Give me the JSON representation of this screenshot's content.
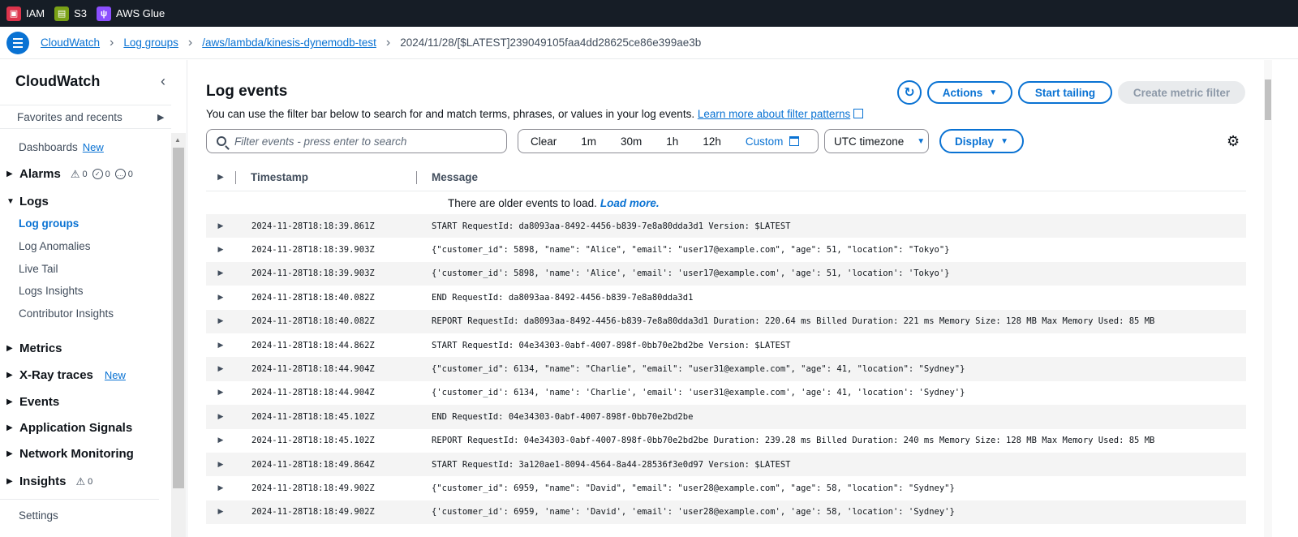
{
  "topbar": {
    "services": [
      {
        "label": "IAM",
        "icon": "iam-icon",
        "color": "#dd344c"
      },
      {
        "label": "S3",
        "icon": "s3-icon",
        "color": "#7aa116"
      },
      {
        "label": "AWS Glue",
        "icon": "glue-icon",
        "color": "#8c4fff"
      }
    ]
  },
  "breadcrumb": {
    "items": [
      "CloudWatch",
      "Log groups",
      "/aws/lambda/kinesis-dynemodb-test"
    ],
    "current": "2024/11/28/[$LATEST]239049105faa4dd28625ce86e399ae3b"
  },
  "sidebar": {
    "title": "CloudWatch",
    "favorites": "Favorites and recents",
    "dashboards": "Dashboards",
    "new_badge": "New",
    "alarms": {
      "label": "Alarms",
      "warn": "0",
      "ok": "0",
      "insufficient": "0"
    },
    "logs": {
      "label": "Logs",
      "items": [
        "Log groups",
        "Log Anomalies",
        "Live Tail",
        "Logs Insights",
        "Contributor Insights"
      ]
    },
    "metrics": "Metrics",
    "xray": "X-Ray traces",
    "events": "Events",
    "app_signals": "Application Signals",
    "network": "Network Monitoring",
    "insights": {
      "label": "Insights",
      "count": "0"
    },
    "settings": "Settings"
  },
  "main": {
    "title": "Log events",
    "description": "You can use the filter bar below to search for and match terms, phrases, or values in your log events.",
    "learn_more": "Learn more about filter patterns",
    "actions": "Actions",
    "start_tailing": "Start tailing",
    "create_metric_filter": "Create metric filter",
    "search_placeholder": "Filter events - press enter to search",
    "range": [
      "Clear",
      "1m",
      "30m",
      "1h",
      "12h"
    ],
    "custom": "Custom",
    "timezone": "UTC timezone",
    "display": "Display",
    "columns": {
      "timestamp": "Timestamp",
      "message": "Message"
    },
    "older_text": "There are older events to load.",
    "load_more": "Load more."
  },
  "rows": [
    {
      "ts": "2024-11-28T18:18:39.861Z",
      "msg": "START RequestId: da8093aa-8492-4456-b839-7e8a80dda3d1 Version: $LATEST"
    },
    {
      "ts": "2024-11-28T18:18:39.903Z",
      "msg": "{\"customer_id\": 5898, \"name\": \"Alice\", \"email\": \"user17@example.com\", \"age\": 51, \"location\": \"Tokyo\"}"
    },
    {
      "ts": "2024-11-28T18:18:39.903Z",
      "msg": "{'customer_id': 5898, 'name': 'Alice', 'email': 'user17@example.com', 'age': 51, 'location': 'Tokyo'}"
    },
    {
      "ts": "2024-11-28T18:18:40.082Z",
      "msg": "END RequestId: da8093aa-8492-4456-b839-7e8a80dda3d1"
    },
    {
      "ts": "2024-11-28T18:18:40.082Z",
      "msg": "REPORT RequestId: da8093aa-8492-4456-b839-7e8a80dda3d1 Duration: 220.64 ms Billed Duration: 221 ms Memory Size: 128 MB Max Memory Used: 85 MB"
    },
    {
      "ts": "2024-11-28T18:18:44.862Z",
      "msg": "START RequestId: 04e34303-0abf-4007-898f-0bb70e2bd2be Version: $LATEST"
    },
    {
      "ts": "2024-11-28T18:18:44.904Z",
      "msg": "{\"customer_id\": 6134, \"name\": \"Charlie\", \"email\": \"user31@example.com\", \"age\": 41, \"location\": \"Sydney\"}"
    },
    {
      "ts": "2024-11-28T18:18:44.904Z",
      "msg": "{'customer_id': 6134, 'name': 'Charlie', 'email': 'user31@example.com', 'age': 41, 'location': 'Sydney'}"
    },
    {
      "ts": "2024-11-28T18:18:45.102Z",
      "msg": "END RequestId: 04e34303-0abf-4007-898f-0bb70e2bd2be"
    },
    {
      "ts": "2024-11-28T18:18:45.102Z",
      "msg": "REPORT RequestId: 04e34303-0abf-4007-898f-0bb70e2bd2be Duration: 239.28 ms Billed Duration: 240 ms Memory Size: 128 MB Max Memory Used: 85 MB"
    },
    {
      "ts": "2024-11-28T18:18:49.864Z",
      "msg": "START RequestId: 3a120ae1-8094-4564-8a44-28536f3e0d97 Version: $LATEST"
    },
    {
      "ts": "2024-11-28T18:18:49.902Z",
      "msg": "{\"customer_id\": 6959, \"name\": \"David\", \"email\": \"user28@example.com\", \"age\": 58, \"location\": \"Sydney\"}"
    },
    {
      "ts": "2024-11-28T18:18:49.902Z",
      "msg": "{'customer_id': 6959, 'name': 'David', 'email': 'user28@example.com', 'age': 58, 'location': 'Sydney'}"
    }
  ]
}
